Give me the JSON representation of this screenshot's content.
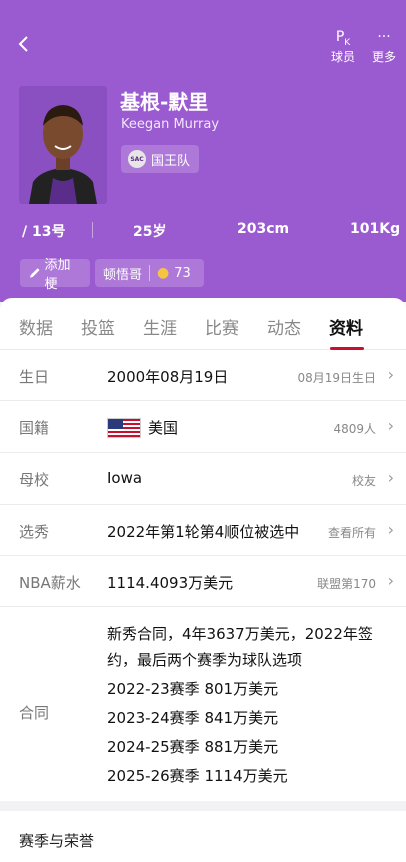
{
  "header": {
    "back_icon": "chevron-left-icon",
    "actions": [
      {
        "icon": "pk-icon",
        "icon_text": "P",
        "label": "球员"
      },
      {
        "icon": "more-icon",
        "icon_text": "···",
        "label": "更多"
      }
    ],
    "player": {
      "name_cn": "基根-默里",
      "name_en": "Keegan Murray",
      "team": "国王队",
      "team_logo_text": "SAC"
    },
    "stats": {
      "number": "/ 13号",
      "age": "25岁",
      "height": "203cm",
      "weight": "101Kg"
    },
    "tags": {
      "add_label": "添加梗",
      "nickname": "顿悟哥",
      "nickname_count": "73"
    }
  },
  "tabs": [
    "数据",
    "投篮",
    "生涯",
    "比赛",
    "动态",
    "资料"
  ],
  "active_tab": "资料",
  "profile": {
    "birthday": {
      "label": "生日",
      "value": "2000年08月19日",
      "right": "08月19日生日"
    },
    "nationality": {
      "label": "国籍",
      "value": "美国",
      "right": "4809人"
    },
    "school": {
      "label": "母校",
      "value": "Iowa",
      "right": "校友"
    },
    "draft": {
      "label": "选秀",
      "value": "2022年第1轮第4顺位被选中",
      "right": "查看所有"
    },
    "salary": {
      "label": "NBA薪水",
      "value": "1114.4093万美元",
      "right": "联盟第170"
    },
    "contract": {
      "label": "合同",
      "summary_line1": "新秀合同，4年3637万美元，2022年签",
      "summary_line2": "约，最后两个赛季为球队选项",
      "seasons": [
        "2022-23赛季 801万美元",
        "2023-24赛季 841万美元",
        "2024-25赛季 881万美元",
        "2025-26赛季 1114万美元"
      ]
    }
  },
  "section_title": "赛季与荣誉"
}
